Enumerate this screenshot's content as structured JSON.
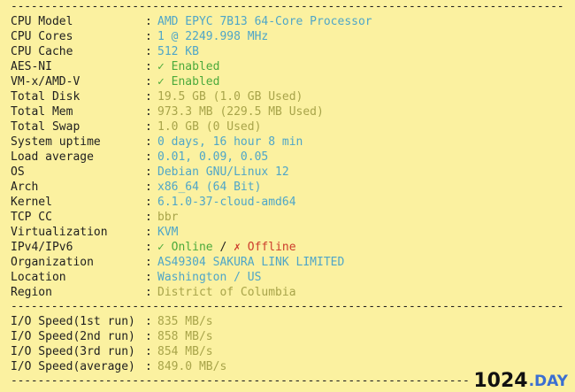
{
  "rule_char": "-",
  "colors": {
    "background": "#fbf1a0",
    "text": "#1f1f1f",
    "blue_value": "#4fa6c8",
    "green_value": "#4caa3c",
    "olive_value": "#a8a44a",
    "red_value": "#cc3d2c"
  },
  "system_info": {
    "colon": ":",
    "rows": [
      {
        "label": "CPU Model",
        "value": "AMD EPYC 7B13 64-Core Processor"
      },
      {
        "label": "CPU Cores",
        "value": "1 @ 2249.998 MHz"
      },
      {
        "label": "CPU Cache",
        "value": "512 KB"
      },
      {
        "label": "AES-NI",
        "value": "✓ Enabled"
      },
      {
        "label": "VM-x/AMD-V",
        "value": "✓ Enabled"
      },
      {
        "label": "Total Disk",
        "value": "19.5 GB (1.0 GB Used)"
      },
      {
        "label": "Total Mem",
        "value": "973.3 MB (229.5 MB Used)"
      },
      {
        "label": "Total Swap",
        "value": "1.0 GB (0 Used)"
      },
      {
        "label": "System uptime",
        "value": "0 days, 16 hour 8 min"
      },
      {
        "label": "Load average",
        "value": "0.01, 0.09, 0.05"
      },
      {
        "label": "OS",
        "value": "Debian GNU/Linux 12"
      },
      {
        "label": "Arch",
        "value": "x86_64 (64 Bit)"
      },
      {
        "label": "Kernel",
        "value": "6.1.0-37-cloud-amd64"
      },
      {
        "label": "TCP CC",
        "value": "bbr"
      },
      {
        "label": "Virtualization",
        "value": "KVM"
      },
      {
        "label": "IPv4/IPv6",
        "value_online": "✓ Online",
        "value_sep": " / ",
        "value_offline": "✗ Offline"
      },
      {
        "label": "Organization",
        "value": "AS49304 SAKURA LINK LIMITED"
      },
      {
        "label": "Location",
        "value": "Washington / US"
      },
      {
        "label": "Region",
        "value": "District of Columbia"
      }
    ]
  },
  "io_speed": {
    "colon": ":",
    "rows": [
      {
        "label": "I/O Speed(1st run)",
        "value": "835 MB/s"
      },
      {
        "label": "I/O Speed(2nd run)",
        "value": "858 MB/s"
      },
      {
        "label": "I/O Speed(3rd run)",
        "value": "854 MB/s"
      },
      {
        "label": "I/O Speed(average)",
        "value": "849.0 MB/s"
      }
    ]
  },
  "watermark": {
    "main": "1024",
    "sub": ".DAY"
  }
}
